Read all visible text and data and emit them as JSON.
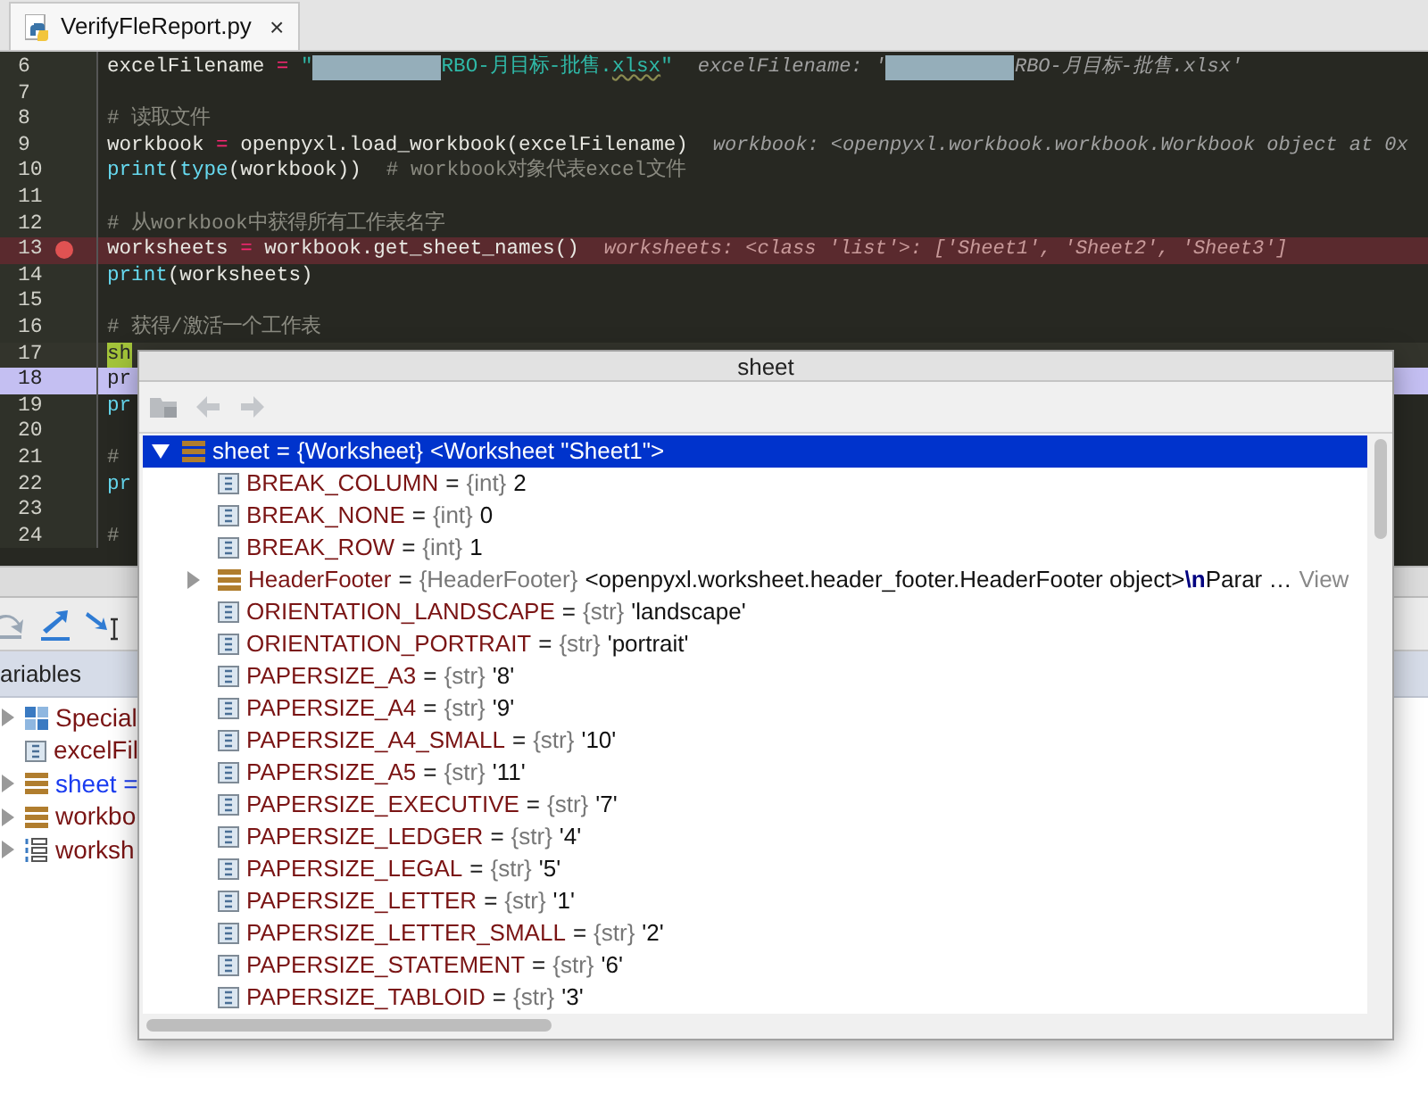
{
  "editor_tab": {
    "title": "VerifyFleReport.py",
    "close": "×",
    "selected": true
  },
  "code_lines": [
    {
      "number": "6",
      "kind": "normal",
      "parts": [
        {
          "kind": "plain",
          "text": "excelFilename "
        },
        {
          "kind": "op",
          "text": "="
        },
        {
          "kind": "string",
          "text": " \""
        },
        {
          "kind": "redacted"
        },
        {
          "kind": "string",
          "text": "RBO-月目标-批售."
        },
        {
          "kind": "typo",
          "text": "xlsx"
        },
        {
          "kind": "string",
          "text": "\""
        },
        {
          "kind": "hint",
          "text": "excelFilename: '"
        },
        {
          "kind": "redacted"
        },
        {
          "kind": "hint_more",
          "text": "RBO-月目标-批售.xlsx'"
        }
      ]
    },
    {
      "number": "7",
      "kind": "normal"
    },
    {
      "number": "8",
      "kind": "normal",
      "parts": [
        {
          "kind": "comment",
          "text": "# 读取文件"
        }
      ]
    },
    {
      "number": "9",
      "kind": "normal",
      "parts": [
        {
          "kind": "plain",
          "text": "workbook "
        },
        {
          "kind": "op",
          "text": "="
        },
        {
          "kind": "plain",
          "text": " openpyxl.load_workbook(excelFilename)"
        },
        {
          "kind": "hint",
          "text": "workbook: <openpyxl.workbook.workbook.Workbook object at 0x"
        }
      ]
    },
    {
      "number": "10",
      "kind": "normal",
      "parts": [
        {
          "kind": "builtin",
          "text": "print"
        },
        {
          "kind": "plain",
          "text": "("
        },
        {
          "kind": "builtin",
          "text": "type"
        },
        {
          "kind": "plain",
          "text": "(workbook))"
        },
        {
          "kind": "trailing_comment",
          "text": "# workbook对象代表excel文件"
        }
      ]
    },
    {
      "number": "11",
      "kind": "normal"
    },
    {
      "number": "12",
      "kind": "normal",
      "parts": [
        {
          "kind": "comment",
          "text": "# 从workbook中获得所有工作表名字"
        }
      ]
    },
    {
      "number": "13",
      "kind": "breakpoint",
      "breakpoint": true,
      "parts": [
        {
          "kind": "plain",
          "text": "worksheets "
        },
        {
          "kind": "op",
          "text": "="
        },
        {
          "kind": "plain",
          "text": " workbook.get_sheet_names()"
        },
        {
          "kind": "hint",
          "text": "worksheets: <class 'list'>: ['Sheet1', 'Sheet2', 'Sheet3']"
        }
      ]
    },
    {
      "number": "14",
      "kind": "normal",
      "parts": [
        {
          "kind": "builtin",
          "text": "print"
        },
        {
          "kind": "plain",
          "text": "(worksheets)"
        }
      ]
    },
    {
      "number": "15",
      "kind": "normal"
    },
    {
      "number": "16",
      "kind": "normal",
      "parts": [
        {
          "kind": "comment",
          "text": "# 获得/激活一个工作表"
        }
      ]
    },
    {
      "number": "17",
      "kind": "caret",
      "parts": [
        {
          "kind": "match",
          "text": "sh"
        }
      ]
    },
    {
      "number": "18",
      "kind": "execution",
      "parts": [
        {
          "kind": "plain",
          "text": "pr"
        }
      ]
    },
    {
      "number": "19",
      "kind": "normal",
      "parts": [
        {
          "kind": "builtin",
          "text": "pr"
        }
      ]
    },
    {
      "number": "20",
      "kind": "normal"
    },
    {
      "number": "21",
      "kind": "normal",
      "parts": [
        {
          "kind": "comment",
          "text": "#"
        }
      ]
    },
    {
      "number": "22",
      "kind": "normal",
      "parts": [
        {
          "kind": "builtin",
          "text": "pr"
        }
      ]
    },
    {
      "number": "23",
      "kind": "normal"
    },
    {
      "number": "24",
      "kind": "normal",
      "parts": [
        {
          "kind": "comment",
          "text": "#"
        }
      ]
    }
  ],
  "variables": {
    "header": "ariables",
    "items": [
      {
        "kind": "special",
        "name": "Special",
        "expandable": true,
        "changed": false
      },
      {
        "kind": "field",
        "name": "excelFil",
        "expandable": false,
        "changed": false
      },
      {
        "kind": "object",
        "name": "sheet =",
        "expandable": true,
        "changed": true
      },
      {
        "kind": "object",
        "name": "workbo",
        "expandable": true,
        "changed": false
      },
      {
        "kind": "list",
        "name": "worksh",
        "expandable": true,
        "changed": false
      }
    ]
  },
  "popup": {
    "title": "sheet",
    "tree": {
      "kind": "object",
      "name": "sheet",
      "equals": "=",
      "type": "{Worksheet}",
      "value": "<Worksheet \"Sheet1\">",
      "expanded": true,
      "selected": true,
      "children": [
        {
          "kind": "field",
          "name": "BREAK_COLUMN",
          "equals": "=",
          "type": "{int}",
          "value": "2",
          "selected": false
        },
        {
          "kind": "field",
          "name": "BREAK_NONE",
          "equals": "=",
          "type": "{int}",
          "value": "0",
          "selected": false
        },
        {
          "kind": "field",
          "name": "BREAK_ROW",
          "equals": "=",
          "type": "{int}",
          "value": "1",
          "selected": false
        },
        {
          "kind": "object",
          "name": "HeaderFooter",
          "equals": "=",
          "type": "{HeaderFooter}",
          "value": "<openpyxl.worksheet.header_footer.HeaderFooter object>**\\n**Parar …",
          "link": "View",
          "expanded": false,
          "selected": false
        },
        {
          "kind": "field",
          "name": "ORIENTATION_LANDSCAPE",
          "equals": "=",
          "type": "{str}",
          "value": "'landscape'",
          "selected": false
        },
        {
          "kind": "field",
          "name": "ORIENTATION_PORTRAIT",
          "equals": "=",
          "type": "{str}",
          "value": "'portrait'",
          "selected": false
        },
        {
          "kind": "field",
          "name": "PAPERSIZE_A3",
          "equals": "=",
          "type": "{str}",
          "value": "'8'",
          "selected": false
        },
        {
          "kind": "field",
          "name": "PAPERSIZE_A4",
          "equals": "=",
          "type": "{str}",
          "value": "'9'",
          "selected": false
        },
        {
          "kind": "field",
          "name": "PAPERSIZE_A4_SMALL",
          "equals": "=",
          "type": "{str}",
          "value": "'10'",
          "selected": false
        },
        {
          "kind": "field",
          "name": "PAPERSIZE_A5",
          "equals": "=",
          "type": "{str}",
          "value": "'11'",
          "selected": false
        },
        {
          "kind": "field",
          "name": "PAPERSIZE_EXECUTIVE",
          "equals": "=",
          "type": "{str}",
          "value": "'7'",
          "selected": false
        },
        {
          "kind": "field",
          "name": "PAPERSIZE_LEDGER",
          "equals": "=",
          "type": "{str}",
          "value": "'4'",
          "selected": false
        },
        {
          "kind": "field",
          "name": "PAPERSIZE_LEGAL",
          "equals": "=",
          "type": "{str}",
          "value": "'5'",
          "selected": false
        },
        {
          "kind": "field",
          "name": "PAPERSIZE_LETTER",
          "equals": "=",
          "type": "{str}",
          "value": "'1'",
          "selected": false
        },
        {
          "kind": "field",
          "name": "PAPERSIZE_LETTER_SMALL",
          "equals": "=",
          "type": "{str}",
          "value": "'2'",
          "selected": false
        },
        {
          "kind": "field",
          "name": "PAPERSIZE_STATEMENT",
          "equals": "=",
          "type": "{str}",
          "value": "'6'",
          "selected": false
        },
        {
          "kind": "field",
          "name": "PAPERSIZE_TABLOID",
          "equals": "=",
          "type": "{str}",
          "value": "'3'",
          "selected": false
        }
      ]
    }
  }
}
